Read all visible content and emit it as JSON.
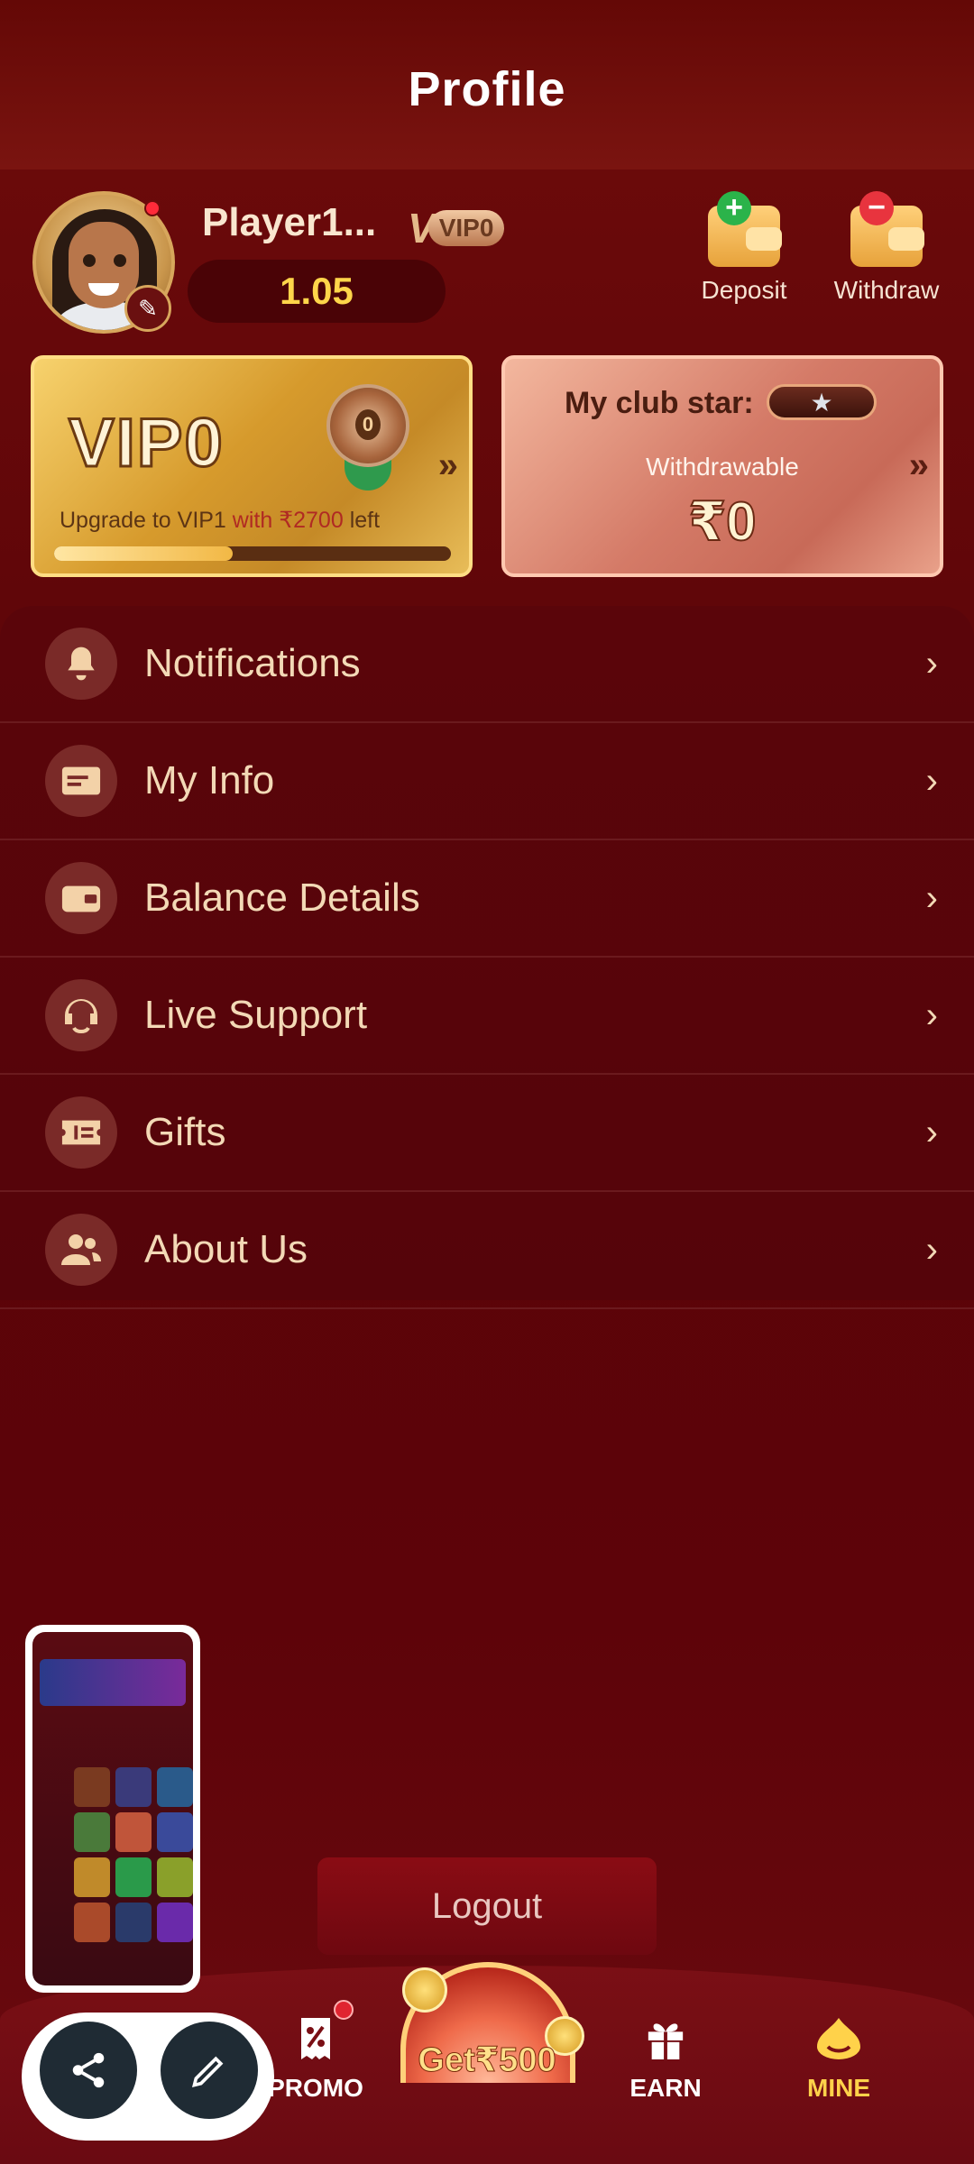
{
  "header": {
    "title": "Profile"
  },
  "profile": {
    "player_name": "Player1...",
    "vip_letter": "V",
    "vip_level": "VIP0",
    "balance": "1.05",
    "deposit_label": "Deposit",
    "withdraw_label": "Withdraw"
  },
  "vip_card": {
    "title": "VIP0",
    "medal_number": "0",
    "upgrade_prefix": "Upgrade to VIP1",
    "upgrade_highlight": "with ₹2700",
    "upgrade_suffix": "left",
    "progress_fraction": 0.45
  },
  "club_card": {
    "label": "My club star:",
    "star_glyph": "★",
    "withdrawable_label": "Withdrawable",
    "amount": "₹0"
  },
  "menu": {
    "items": [
      {
        "label": "Notifications",
        "icon": "bell-icon"
      },
      {
        "label": "My Info",
        "icon": "id-card-icon"
      },
      {
        "label": "Balance Details",
        "icon": "wallet-icon"
      },
      {
        "label": "Live Support",
        "icon": "headset-icon"
      },
      {
        "label": "Gifts",
        "icon": "ticket-icon"
      },
      {
        "label": "About Us",
        "icon": "users-icon"
      }
    ]
  },
  "logout_label": "Logout",
  "bottom_nav": {
    "promo": "PROMO",
    "spin": "Get₹500",
    "earn": "EARN",
    "mine": "MINE"
  },
  "colors": {
    "background": "#5a0408",
    "accent_gold": "#ffd24a",
    "badge_red": "#ff2b3a"
  }
}
